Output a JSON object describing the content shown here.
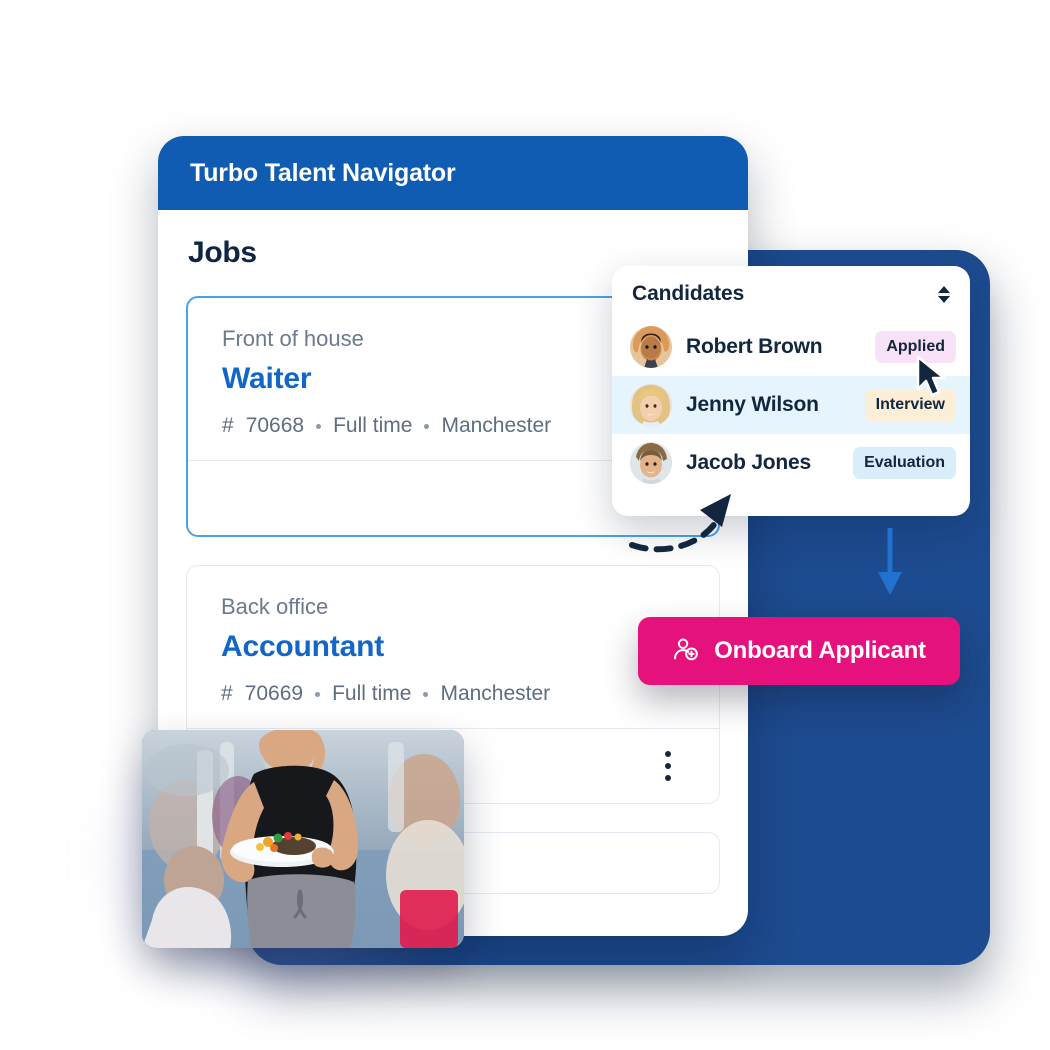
{
  "app": {
    "title": "Turbo Talent Navigator",
    "page_title": "Jobs",
    "header_color": "#0f5cb2",
    "accent_color": "#1166c8"
  },
  "jobs": [
    {
      "department": "Front of house",
      "title": "Waiter",
      "hash": "#",
      "id": "70668",
      "employment_type": "Full time",
      "location": "Manchester",
      "menu_icon": "kebab-menu-icon",
      "selected": true
    },
    {
      "department": "Back office",
      "title": "Accountant",
      "hash": "#",
      "id": "70669",
      "employment_type": "Full time",
      "location": "Manchester",
      "menu_icon": "kebab-menu-icon",
      "selected": false
    }
  ],
  "candidates_panel": {
    "title": "Candidates",
    "sort_icon": "sort-updown-icon",
    "rows": [
      {
        "name": "Robert Brown",
        "status": "Applied",
        "status_bg": "#f9e2f7",
        "avatar": "avatar-robert-brown",
        "highlighted": false
      },
      {
        "name": "Jenny Wilson",
        "status": "Interview",
        "status_bg": "#fdefd7",
        "avatar": "avatar-jenny-wilson",
        "highlighted": true
      },
      {
        "name": "Jacob Jones",
        "status": "Evaluation",
        "status_bg": "#d9edfb",
        "avatar": "avatar-jacob-jones",
        "highlighted": false
      }
    ]
  },
  "onboard_button": {
    "label": "Onboard Applicant",
    "icon": "person-add-icon",
    "color": "#e5127d"
  },
  "photo_card": {
    "alt": "waiter-carrying-plate-photo"
  },
  "annotations": {
    "curved_arrow": "dashed-curved-arrow-to-candidates",
    "down_arrow": "blue-down-arrow-to-onboard-button",
    "cursor": "mouse-pointer-cursor"
  }
}
